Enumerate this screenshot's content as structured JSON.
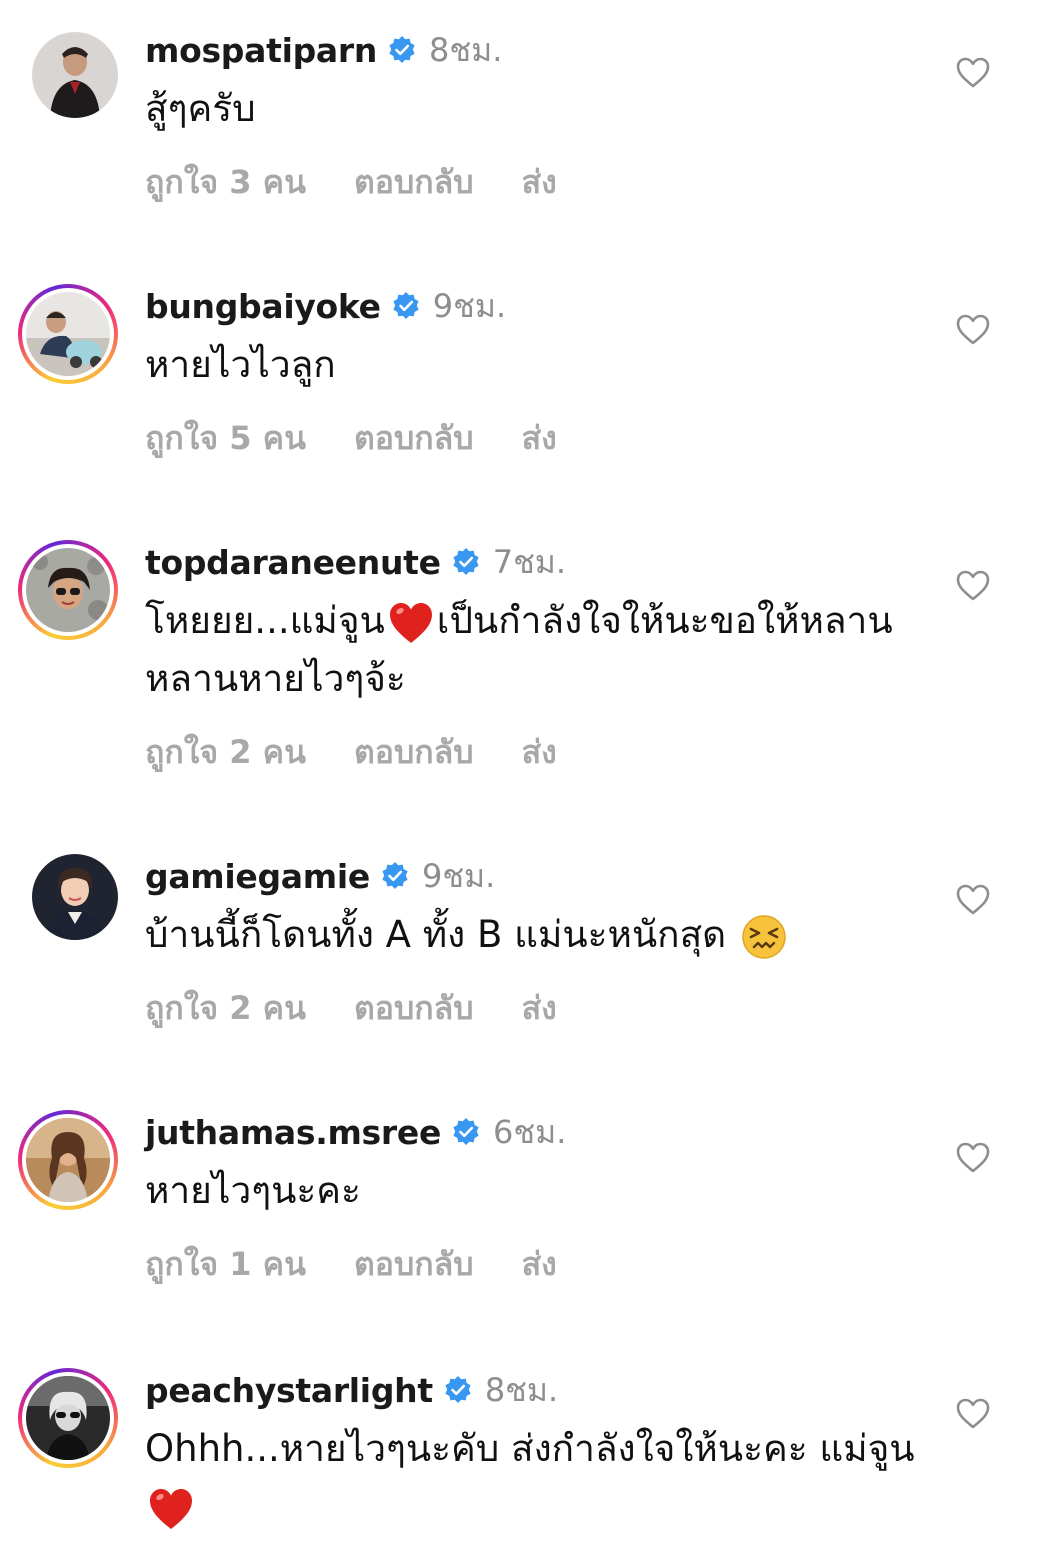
{
  "comments": [
    {
      "username": "mospatiparn",
      "time": "8ชม.",
      "text": "สู้ๆครับ",
      "emoji": "",
      "text_after": "",
      "likes": "ถูกใจ 3 คน",
      "reply": "ตอบกลับ",
      "send": "ส่ง",
      "story_ring": false
    },
    {
      "username": "bungbaiyoke",
      "time": "9ชม.",
      "text": "หายไวไวลูก",
      "emoji": "",
      "text_after": "",
      "likes": "ถูกใจ 5 คน",
      "reply": "ตอบกลับ",
      "send": "ส่ง",
      "story_ring": true
    },
    {
      "username": "topdaraneenute",
      "time": "7ชม.",
      "text": "โหยยย...แม่จูน",
      "emoji": "red-heart-emoji",
      "text_after": "เป็นกำลังใจให้นะขอให้หลานหลานหายไวๆจ้ะ",
      "likes": "ถูกใจ 2 คน",
      "reply": "ตอบกลับ",
      "send": "ส่ง",
      "story_ring": true
    },
    {
      "username": "gamiegamie",
      "time": "9ชม.",
      "text": "บ้านนี้ก็โดนทั้ง A ทั้ง B แม่นะหนักสุด",
      "emoji": "confounded-face-emoji",
      "text_after": "",
      "likes": "ถูกใจ 2 คน",
      "reply": "ตอบกลับ",
      "send": "ส่ง",
      "story_ring": false
    },
    {
      "username": "juthamas.msree",
      "time": "6ชม.",
      "text": "หายไวๆนะคะ",
      "emoji": "",
      "text_after": "",
      "likes": "ถูกใจ 1 คน",
      "reply": "ตอบกลับ",
      "send": "ส่ง",
      "story_ring": true
    },
    {
      "username": "peachystarlight",
      "time": "8ชม.",
      "text": "Ohhh...หายไวๆนะคับ ส่งกำลังใจให้นะคะ แม่จูน",
      "emoji": "red-heart-emoji",
      "text_after": "",
      "likes": "",
      "reply": "",
      "send": "",
      "story_ring": true
    }
  ],
  "icons": {
    "verified": "verified-badge-icon",
    "like": "heart-outline-icon"
  },
  "colors": {
    "verified_blue": "#3897f0",
    "muted_text": "#8e8e8e",
    "action_text": "#a8a8a8"
  }
}
